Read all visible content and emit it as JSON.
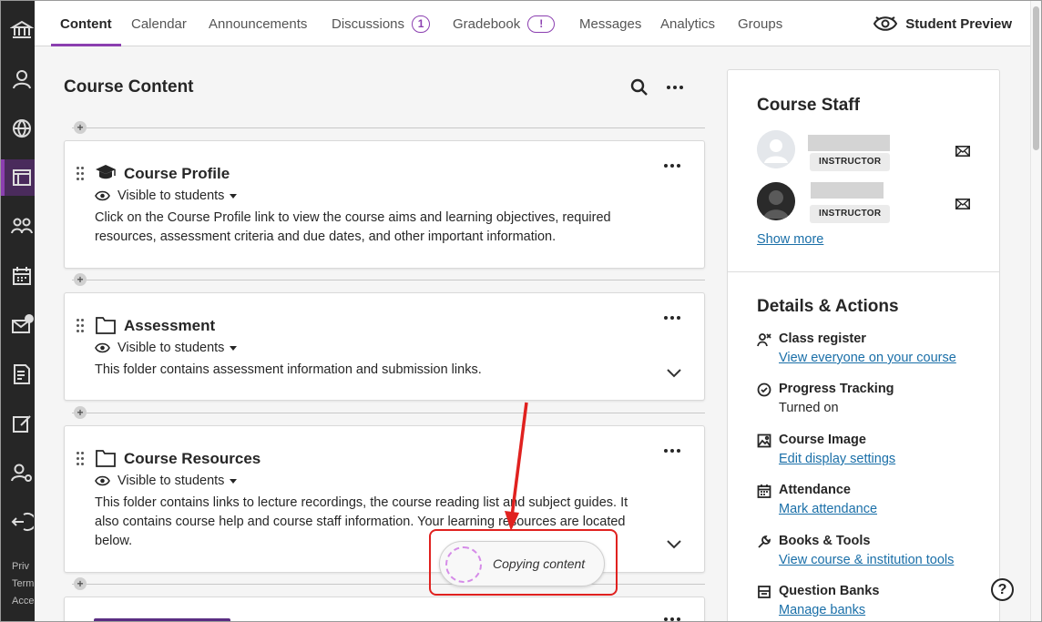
{
  "nav": {
    "tabs": [
      {
        "label": "Content"
      },
      {
        "label": "Calendar"
      },
      {
        "label": "Announcements"
      },
      {
        "label": "Discussions",
        "badge": "1"
      },
      {
        "label": "Gradebook",
        "badge": "!"
      },
      {
        "label": "Messages"
      },
      {
        "label": "Analytics"
      },
      {
        "label": "Groups"
      }
    ],
    "student_preview": "Student Preview"
  },
  "rail": {
    "icons": [
      "institution-icon",
      "profile-icon",
      "globe-icon",
      "courses-icon",
      "groups-icon",
      "calendar-icon",
      "messages-icon",
      "grades-icon",
      "tools-icon",
      "admin-icon",
      "sign-out-icon"
    ],
    "footer": [
      "Priv",
      "Term",
      "Acce"
    ]
  },
  "content": {
    "heading": "Course Content",
    "items": [
      {
        "title": "Course Profile",
        "type_icon": "mortarboard-icon",
        "visibility": "Visible to students",
        "description": "Click on the Course Profile link to view the course aims and learning objectives, required resources, assessment criteria and due dates, and other important information.",
        "expandable": false
      },
      {
        "title": "Assessment",
        "type_icon": "folder-icon",
        "visibility": "Visible to students",
        "description": "This folder contains assessment information and submission links.",
        "expandable": true
      },
      {
        "title": "Course Resources",
        "type_icon": "folder-icon",
        "visibility": "Visible to students",
        "description": "This folder contains links to lecture recordings, the course reading list and subject guides. It also contains course help and course staff information. Your learning resources are located below.",
        "expandable": true
      }
    ]
  },
  "sidebar": {
    "staff_heading": "Course Staff",
    "staff": [
      {
        "role": "INSTRUCTOR"
      },
      {
        "role": "INSTRUCTOR"
      }
    ],
    "show_more": "Show more",
    "details_heading": "Details & Actions",
    "actions": [
      {
        "label": "Class register",
        "sub": "View everyone on your course",
        "sub_is_link": true,
        "icon": "register-icon"
      },
      {
        "label": "Progress Tracking",
        "sub": "Turned on",
        "sub_is_link": false,
        "icon": "check-circle-icon"
      },
      {
        "label": "Course Image",
        "sub": "Edit display settings",
        "sub_is_link": true,
        "icon": "image-icon"
      },
      {
        "label": "Attendance",
        "sub": "Mark attendance",
        "sub_is_link": true,
        "icon": "attendance-icon"
      },
      {
        "label": "Books & Tools",
        "sub": "View course & institution tools",
        "sub_is_link": true,
        "icon": "wrench-icon"
      },
      {
        "label": "Question Banks",
        "sub": "Manage banks",
        "sub_is_link": true,
        "icon": "question-bank-icon"
      }
    ]
  },
  "toast": {
    "message": "Copying content"
  },
  "help": {
    "label": "?"
  },
  "colors": {
    "accent": "#8b3fb0",
    "link": "#1a6fa8",
    "annotation": "#e0211f",
    "rail": "#262626"
  }
}
